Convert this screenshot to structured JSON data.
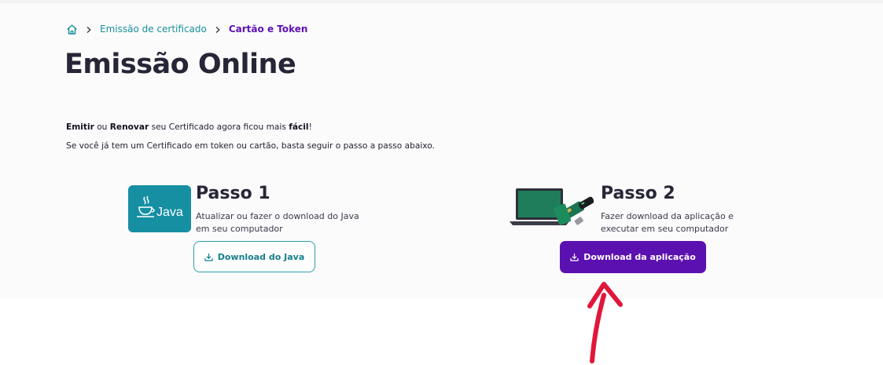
{
  "breadcrumb": {
    "home_icon": "home-icon",
    "items": [
      {
        "label": "Emissão de certificado"
      },
      {
        "label": "Cartão e Token"
      }
    ]
  },
  "page": {
    "title": "Emissão Online",
    "intro_line1": {
      "part1": "Emitir",
      "part2": " ou ",
      "part3": "Renovar",
      "part4": " seu Certificado agora ficou mais ",
      "part5": "fácil",
      "part6": "!"
    },
    "intro_line2": "Se você já tem um Certificado em token ou cartão, basta seguir o passo a passo abaixo."
  },
  "steps": [
    {
      "title": "Passo 1",
      "desc_line1": "Atualizar ou fazer o download do Java",
      "desc_line2": "em seu computador",
      "button_label": "Download do Java",
      "logo_text": "Java"
    },
    {
      "title": "Passo 2",
      "desc_line1": "Fazer download da aplicação e",
      "desc_line2": "executar em seu computador",
      "button_label": "Download da aplicação"
    }
  ],
  "colors": {
    "accent_teal": "#18909a",
    "accent_purple": "#5b10b0",
    "annotation_red": "#e0173a"
  }
}
